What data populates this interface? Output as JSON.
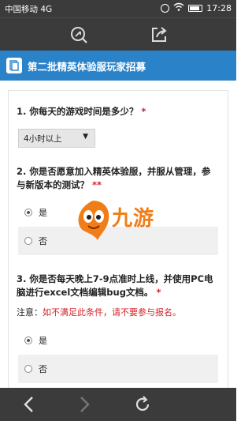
{
  "status_bar": {
    "carrier": "中国移动 4G",
    "time": "17:28"
  },
  "browser": {
    "toolbar_icons": [
      "search-icon",
      "share-icon"
    ],
    "bottom_icons": [
      "back-icon",
      "forward-icon",
      "refresh-icon"
    ]
  },
  "page": {
    "title": "第二批精英体验服玩家招募"
  },
  "questions": [
    {
      "text": "1. 你每天的游戏时间是多少？",
      "required": "*",
      "selected": "4小时以上"
    },
    {
      "text": "2. 你是否愿意加入精英体验服，并服从管理，参与新版本的测试？",
      "required": "**",
      "options": [
        "是",
        "否"
      ],
      "selected_index": 0
    },
    {
      "text": "3. 你是否每天晚上7-9点准时上线，并使用PC电脑进行excel文档编辑bug文档。",
      "required": "*",
      "note_label": "注意：",
      "note_warn": "如不满足此条件，请不要参与报名。",
      "options": [
        "是",
        "否"
      ],
      "selected_index": 0
    }
  ],
  "watermark": {
    "text": "九游"
  },
  "colors": {
    "banner": "#2a82c9",
    "required": "#d4232a",
    "watermark": "#f07d17",
    "bars": "#3b3b3b"
  }
}
